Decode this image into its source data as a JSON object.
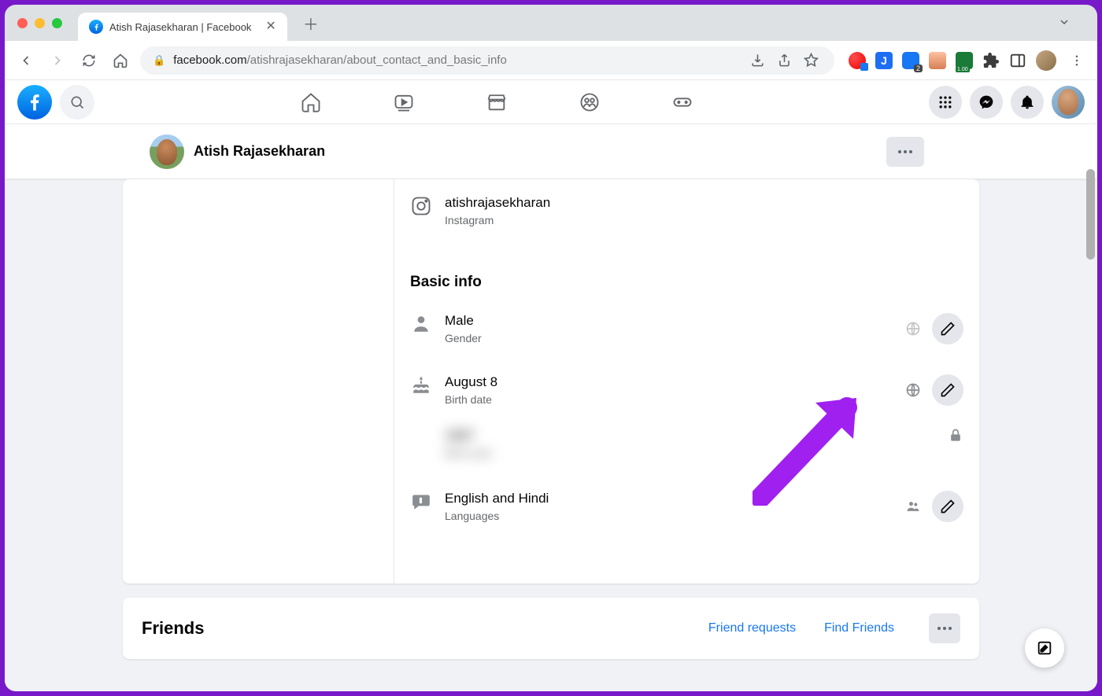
{
  "browser": {
    "tab_title": "Atish Rajasekharan | Facebook",
    "url_domain": "facebook.com",
    "url_path": "/atishrajasekharan/about_contact_and_basic_info"
  },
  "profile": {
    "name": "Atish Rajasekharan"
  },
  "instagram": {
    "handle": "atishrajasekharan",
    "label": "Instagram"
  },
  "basic_info": {
    "section_title": "Basic info",
    "gender": {
      "value": "Male",
      "label": "Gender"
    },
    "birth_date": {
      "value": "August 8",
      "label": "Birth date"
    },
    "hidden": {
      "value": "1997",
      "label": "Birth year"
    },
    "languages": {
      "value": "English and Hindi",
      "label": "Languages"
    }
  },
  "friends": {
    "title": "Friends",
    "requests": "Friend requests",
    "find": "Find Friends"
  }
}
